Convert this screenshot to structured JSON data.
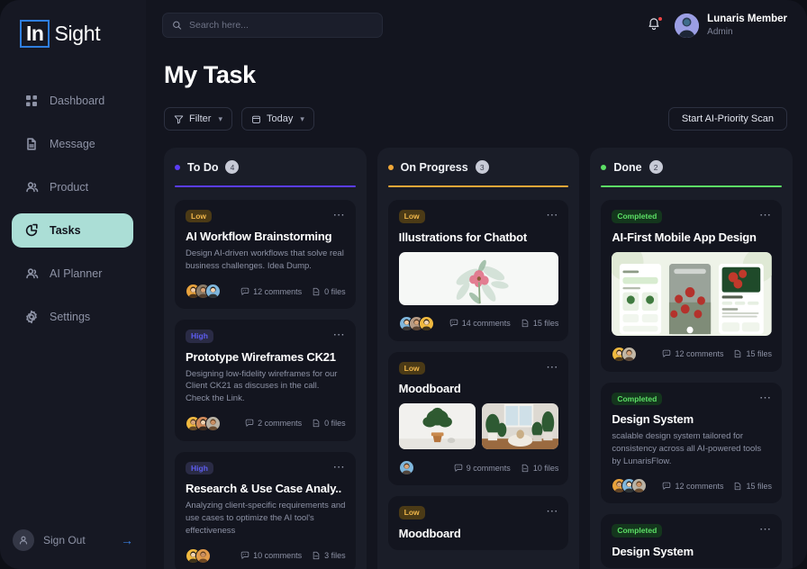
{
  "brand": {
    "mark": "In",
    "name": "Sight"
  },
  "sidebar": {
    "items": [
      {
        "label": "Dashboard",
        "icon": "grid-icon",
        "active": false
      },
      {
        "label": "Message",
        "icon": "document-icon",
        "active": false
      },
      {
        "label": "Product",
        "icon": "users-icon",
        "active": false
      },
      {
        "label": "Tasks",
        "icon": "pie-chart-icon",
        "active": true
      },
      {
        "label": "AI Planner",
        "icon": "users-icon",
        "active": false
      },
      {
        "label": "Settings",
        "icon": "gear-icon",
        "active": false
      }
    ],
    "sign_out": {
      "label": "Sign Out",
      "arrow": "→"
    }
  },
  "topbar": {
    "search": {
      "placeholder": "Search here...",
      "value": ""
    },
    "notifications": {
      "has_unread": true
    },
    "user": {
      "name": "Lunaris Member",
      "role": "Admin"
    }
  },
  "page": {
    "title": "My Task",
    "filter_label": "Filter",
    "date_label": "Today",
    "scan_button": "Start AI-Priority Scan",
    "chevron": "⌄"
  },
  "colors": {
    "todo": "#5b3df5",
    "progress": "#efa738",
    "done": "#5ce065",
    "accent_mint": "#abded6",
    "brand_blue": "#2f7fe0",
    "notification_red": "#ef4444"
  },
  "columns": [
    {
      "id": "todo",
      "title": "To Do",
      "count": "4",
      "dot_color": "#5b3df5",
      "rule_color": "#5b3df5",
      "cards": [
        {
          "badge": "Low",
          "badge_type": "low",
          "title": "AI Workflow Brainstorming",
          "desc": "Design AI-driven workflows that solve real business challenges. Idea Dump.",
          "avatars": [
            "#e8a23c",
            "#8b7d6b",
            "#7fb7dd"
          ],
          "comments": "12 comments",
          "files": "0 files",
          "thumbs": []
        },
        {
          "badge": "High",
          "badge_type": "high",
          "title": "Prototype Wireframes CK21",
          "desc": "Designing low-fidelity wireframes for our Client CK21 as discuses in the call. Check the Link.",
          "avatars": [
            "#f0b93f",
            "#d08a5a",
            "#b9b2a4"
          ],
          "comments": "2 comments",
          "files": "0 files",
          "thumbs": []
        },
        {
          "badge": "High",
          "badge_type": "high",
          "title": "Research & Use Case Analy..",
          "desc": "Analyzing client-specific requirements and use cases to optimize the AI tool's effectiveness",
          "avatars": [
            "#f0b93f",
            "#e09a4a"
          ],
          "comments": "10 comments",
          "files": "3 files",
          "thumbs": []
        }
      ]
    },
    {
      "id": "progress",
      "title": "On Progress",
      "count": "3",
      "dot_color": "#efa738",
      "rule_color": "#efa738",
      "cards": [
        {
          "badge": "Low",
          "badge_type": "low",
          "title": "Illustrations for Chatbot",
          "desc": "",
          "avatars": [
            "#7fb7dd",
            "#b79b84",
            "#f0b93f"
          ],
          "comments": "14 comments",
          "files": "15 files",
          "thumbs": [
            "floral-illustration"
          ]
        },
        {
          "badge": "Low",
          "badge_type": "low",
          "title": "Moodboard",
          "desc": "",
          "avatars": [
            "#7fb7dd"
          ],
          "comments": "9 comments",
          "files": "10 files",
          "thumbs": [
            "plant-on-table",
            "living-room-plants"
          ]
        },
        {
          "badge": "Low",
          "badge_type": "low",
          "title": "Moodboard",
          "desc": "",
          "avatars": [],
          "comments": "",
          "files": "",
          "thumbs": []
        }
      ]
    },
    {
      "id": "done",
      "title": "Done",
      "count": "2",
      "dot_color": "#5ce065",
      "rule_color": "#5ce065",
      "cards": [
        {
          "badge": "Completed",
          "badge_type": "completed",
          "title": "AI-First Mobile App Design",
          "desc": "",
          "avatars": [
            "#f0b93f",
            "#c2b7a6"
          ],
          "comments": "12 comments",
          "files": "15 files",
          "thumbs": [
            "mobile-app-screens"
          ]
        },
        {
          "badge": "Completed",
          "badge_type": "completed",
          "title": "Design System",
          "desc": "scalable design system tailored for consistency across all AI-powered tools by LunarisFlow.",
          "avatars": [
            "#e8a23c",
            "#7fb7dd",
            "#b9b2a4"
          ],
          "comments": "12 comments",
          "files": "15 files",
          "thumbs": []
        },
        {
          "badge": "Completed",
          "badge_type": "completed",
          "title": "Design System",
          "desc": "",
          "avatars": [],
          "comments": "",
          "files": "",
          "thumbs": []
        }
      ]
    }
  ]
}
